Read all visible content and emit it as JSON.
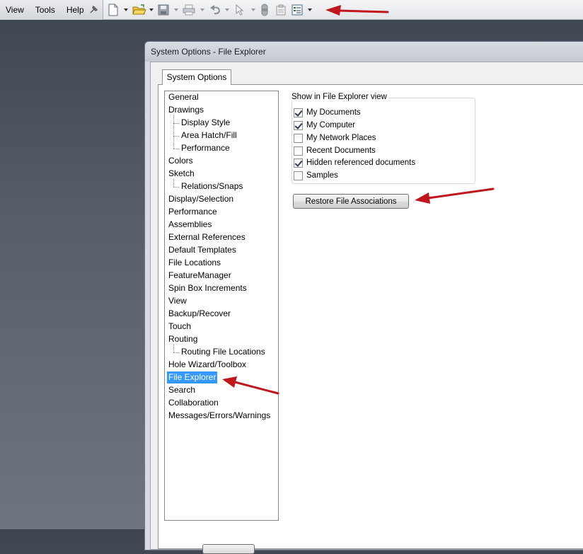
{
  "menubar": {
    "items": [
      "View",
      "Tools",
      "Help"
    ]
  },
  "toolbar": {
    "icons": [
      "pin-icon",
      "new-document-icon",
      "open-folder-icon",
      "save-icon",
      "print-icon",
      "undo-icon",
      "select-pointer-icon",
      "rebuild-icon",
      "file-properties-icon",
      "options-icon"
    ]
  },
  "dialog": {
    "title": "System Options - File Explorer",
    "tab_label": "System Options",
    "tree": [
      {
        "label": "General",
        "level": 0
      },
      {
        "label": "Drawings",
        "level": 0
      },
      {
        "label": "Display Style",
        "level": 1
      },
      {
        "label": "Area Hatch/Fill",
        "level": 1
      },
      {
        "label": "Performance",
        "level": 1
      },
      {
        "label": "Colors",
        "level": 0
      },
      {
        "label": "Sketch",
        "level": 0
      },
      {
        "label": "Relations/Snaps",
        "level": 1
      },
      {
        "label": "Display/Selection",
        "level": 0
      },
      {
        "label": "Performance",
        "level": 0
      },
      {
        "label": "Assemblies",
        "level": 0
      },
      {
        "label": "External References",
        "level": 0
      },
      {
        "label": "Default Templates",
        "level": 0
      },
      {
        "label": "File Locations",
        "level": 0
      },
      {
        "label": "FeatureManager",
        "level": 0
      },
      {
        "label": "Spin Box Increments",
        "level": 0
      },
      {
        "label": "View",
        "level": 0
      },
      {
        "label": "Backup/Recover",
        "level": 0
      },
      {
        "label": "Touch",
        "level": 0
      },
      {
        "label": "Routing",
        "level": 0
      },
      {
        "label": "Routing File Locations",
        "level": 1
      },
      {
        "label": "Hole Wizard/Toolbox",
        "level": 0
      },
      {
        "label": "File Explorer",
        "level": 0,
        "selected": true
      },
      {
        "label": "Search",
        "level": 0
      },
      {
        "label": "Collaboration",
        "level": 0
      },
      {
        "label": "Messages/Errors/Warnings",
        "level": 0
      }
    ],
    "group_title": "Show in File Explorer view",
    "checkboxes": [
      {
        "label": "My Documents",
        "checked": true
      },
      {
        "label": "My Computer",
        "checked": true
      },
      {
        "label": "My Network Places",
        "checked": false
      },
      {
        "label": "Recent Documents",
        "checked": false
      },
      {
        "label": "Hidden referenced documents",
        "checked": true
      },
      {
        "label": "Samples",
        "checked": false
      }
    ],
    "restore_button_label": "Restore File Associations"
  },
  "colors": {
    "annotation_arrow": "#c0161c",
    "selection": "#3399ff"
  }
}
